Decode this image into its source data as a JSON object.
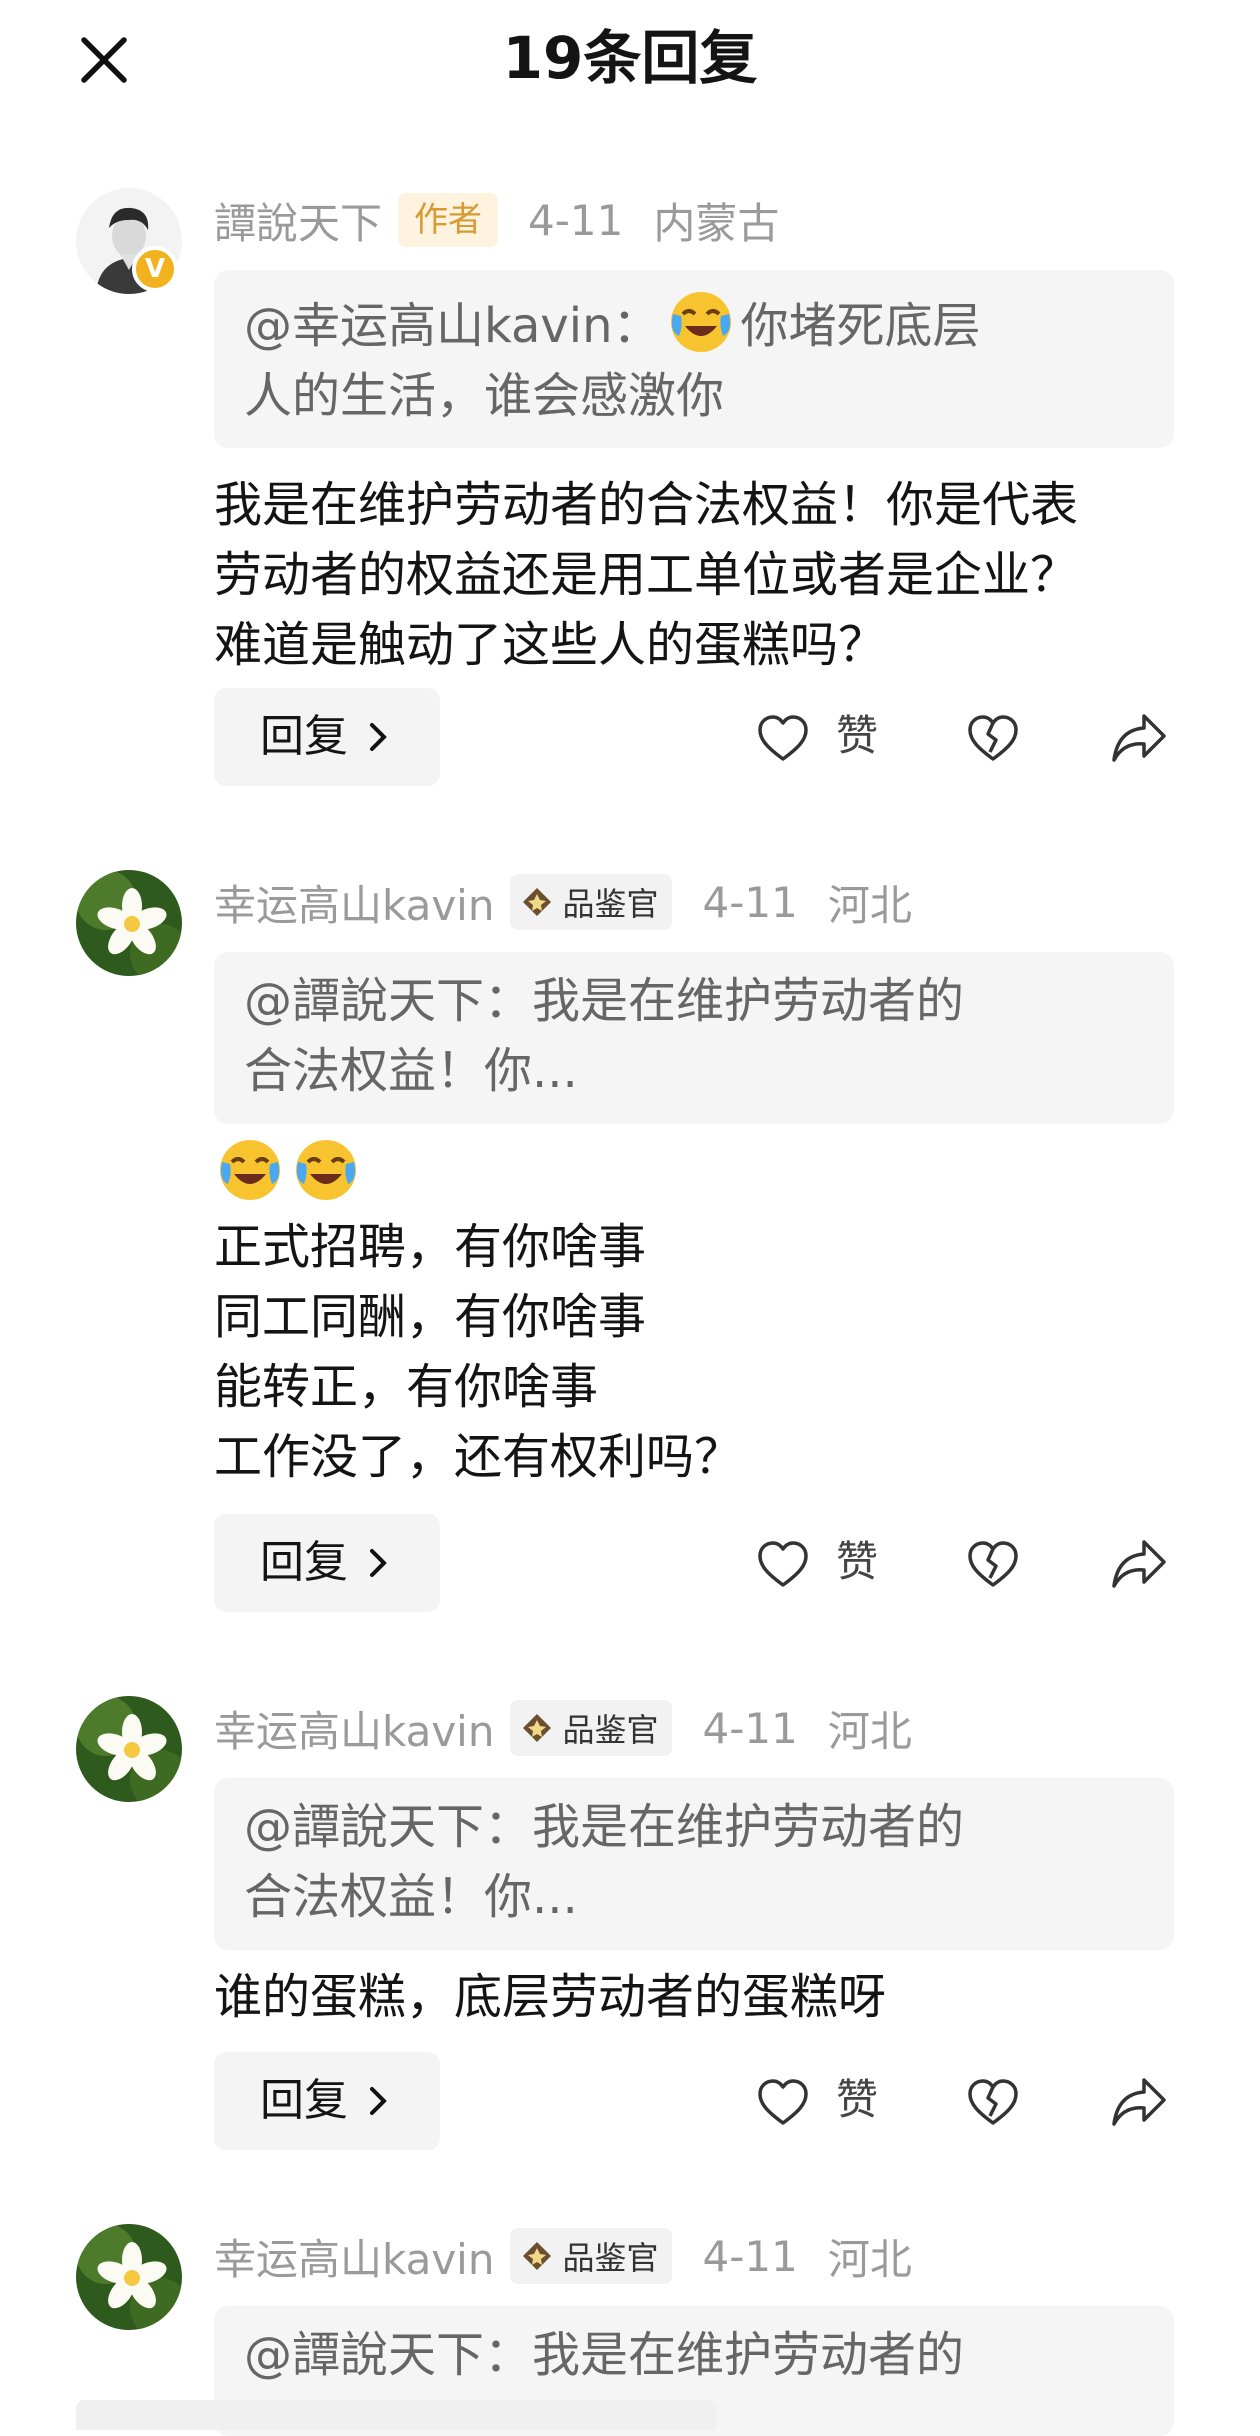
{
  "header": {
    "title": "19条回复"
  },
  "comments": [
    {
      "username": "譚說天下",
      "tag": "作者",
      "date": "4-11",
      "location": "内蒙古",
      "avatar_badge": "V",
      "quote_lines": [
        "@幸运高山kavin：",
        "你堵死底层",
        "人的生活，谁会感激你"
      ],
      "body_lines": [
        "我是在维护劳动者的合法权益！你是代表",
        "劳动者的权益还是用工单位或者是企业？",
        "难道是触动了这些人的蛋糕吗？"
      ]
    },
    {
      "username": "幸运高山kavin",
      "tag": "品鉴官",
      "date": "4-11",
      "location": "河北",
      "quote_lines": [
        "@譚說天下：我是在维护劳动者的",
        "合法权益！你..."
      ],
      "body_lines": [
        "正式招聘，有你啥事",
        "同工同酬，有你啥事",
        "能转正，有你啥事",
        "工作没了，还有权利吗？"
      ]
    },
    {
      "username": "幸运高山kavin",
      "tag": "品鉴官",
      "date": "4-11",
      "location": "河北",
      "quote_lines": [
        "@譚說天下：我是在维护劳动者的",
        "合法权益！你..."
      ],
      "body_lines": [
        "谁的蛋糕，底层劳动者的蛋糕呀"
      ]
    },
    {
      "username": "幸运高山kavin",
      "tag": "品鉴官",
      "date": "4-11",
      "location": "河北",
      "quote_lines": [
        "@譚說天下：我是在维护劳动者的"
      ]
    }
  ],
  "actions": {
    "reply_label": "回复",
    "like_label": "赞"
  },
  "icons": {
    "close": "close-icon",
    "like": "heart-outline-icon",
    "dislike": "broken-heart-icon",
    "share": "share-arrow-icon",
    "reply_chevron": "chevron-right-icon",
    "emoji": "laughing-tears-emoji",
    "rank": "diamond-badge-icon"
  },
  "colors": {
    "author_tag_bg": "#fdf3df",
    "author_tag_text": "#d99a34",
    "verified_badge": "#f2b21e",
    "meta_text": "#9a9a9a"
  }
}
